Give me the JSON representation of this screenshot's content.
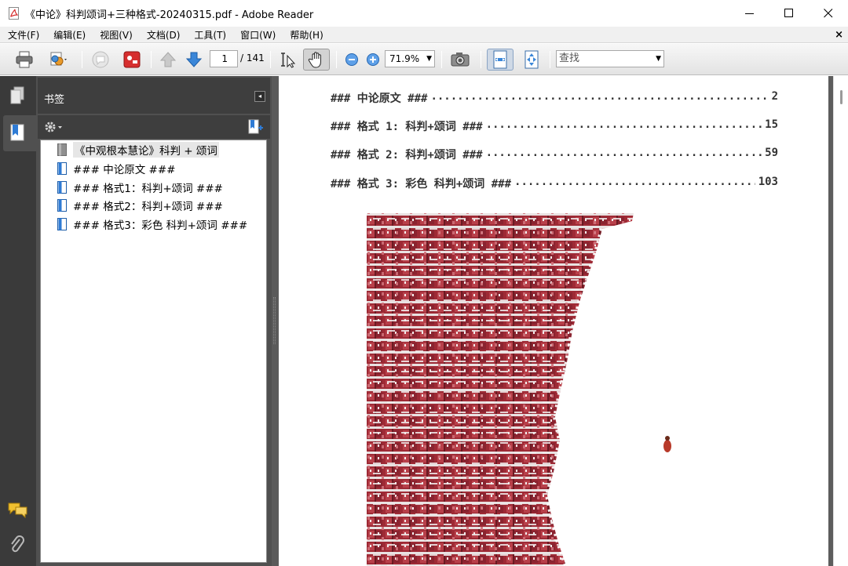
{
  "window": {
    "title": "《中论》科判颂词+三种格式-20240315.pdf - Adobe Reader",
    "minimize_glyph": "—",
    "maximize_glyph": "☐",
    "close_glyph": "✕"
  },
  "menu": {
    "items": [
      "文件(F)",
      "编辑(E)",
      "视图(V)",
      "文档(D)",
      "工具(T)",
      "窗口(W)",
      "帮助(H)"
    ],
    "close_glyph": "×"
  },
  "toolbar": {
    "page_current": "1",
    "page_total": "/ 141",
    "zoom": "71.9%",
    "find_placeholder": "查找",
    "dropdown_glyph": "▼"
  },
  "nav": {
    "panel_title": "书签",
    "collapse_glyph": "◂",
    "bookmarks": [
      {
        "label": "《中观根本慧论》科判 + 颂词",
        "selected": true
      },
      {
        "label": "### 中论原文 ###"
      },
      {
        "label": "### 格式1：科判+颂词 ###"
      },
      {
        "label": "### 格式2：科判+颂词 ###"
      },
      {
        "label": "### 格式3：彩色 科判+颂词 ###"
      }
    ]
  },
  "document": {
    "toc": [
      {
        "title": "### 中论原文 ###",
        "page": "2"
      },
      {
        "title": "### 格式 1: 科判+颂词 ###",
        "page": "15"
      },
      {
        "title": "### 格式 2: 科判+颂词 ###",
        "page": "59"
      },
      {
        "title": "### 格式 3: 彩色 科判+颂词 ###",
        "page": "103"
      }
    ],
    "toc_leader": ".............................................................................................."
  },
  "colors": {
    "accent_blue": "#2f7bd4",
    "red_icon": "#d62e2e",
    "house_red": "#a8323c"
  }
}
